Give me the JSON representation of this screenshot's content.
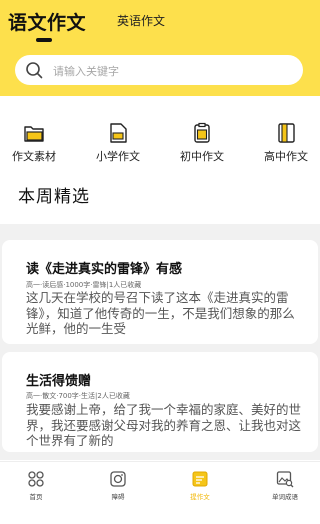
{
  "header": {
    "tabs": [
      "语文作文",
      "英语作文"
    ],
    "active_tab": "语文作文"
  },
  "search": {
    "placeholder": "请输入关键字",
    "icon": "search-icon"
  },
  "categories": [
    {
      "label": "作文素材",
      "icon": "folder-icon"
    },
    {
      "label": "小学作文",
      "icon": "document-icon"
    },
    {
      "label": "初中作文",
      "icon": "clipboard-icon"
    },
    {
      "label": "高中作文",
      "icon": "book-icon"
    }
  ],
  "weekly": {
    "title": "本周精选",
    "articles": [
      {
        "title": "读《走进真实的雷锋》有感",
        "meta": "高一·读后感·1000字·雷锋|1人已收藏",
        "excerpt": "这几天在学校的号召下读了这本《走进真实的雷锋》，知道了他传奇的一生，不是我们想象的那么光鲜，他的一生受"
      },
      {
        "title": "生活得馈赠",
        "meta": "高一·散文·700字·生活|2人已收藏",
        "excerpt": "我要感谢上帝，给了我一个幸福的家庭、美好的世界，我还要感谢父母对我的养育之恩、让我也对这个世界有了新的"
      }
    ]
  },
  "bottom_nav": [
    {
      "label": "首页",
      "icon": "grid-icon"
    },
    {
      "label": "障碍",
      "icon": "camera-icon"
    },
    {
      "label": "提作文",
      "icon": "edit-icon"
    },
    {
      "label": "单词成语",
      "icon": "image-search-icon"
    }
  ],
  "colors": {
    "header_bg": "#fde04c",
    "accent": "#f2b600",
    "folder": "#f5c518"
  }
}
